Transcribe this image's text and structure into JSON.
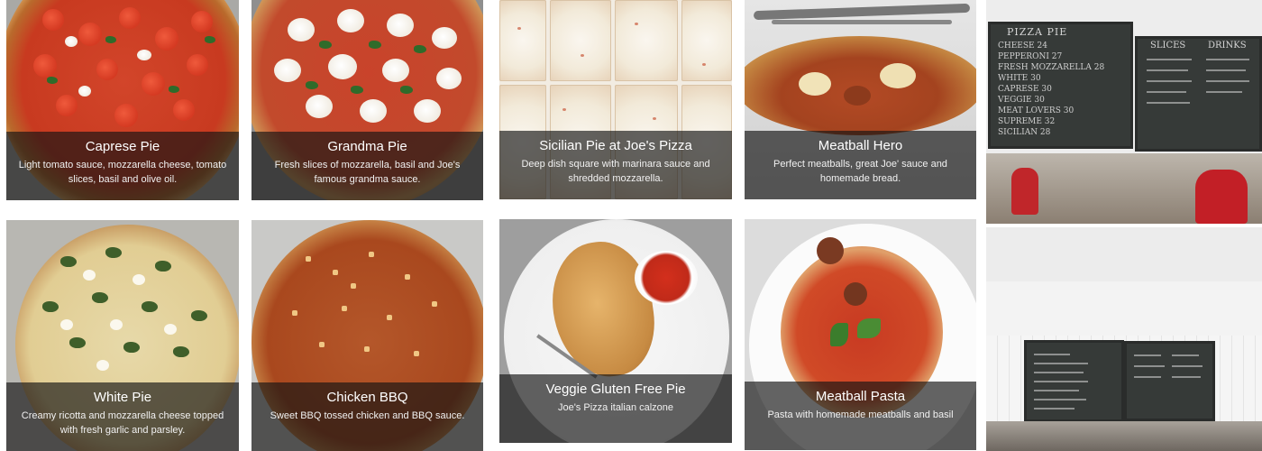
{
  "menu_cards": [
    {
      "title": "Caprese Pie",
      "desc": "Light tomato sauce, mozzarella cheese, tomato slices, basil and olive oil."
    },
    {
      "title": "Grandma Pie",
      "desc": "Fresh slices of mozzarella, basil and Joe's famous grandma sauce."
    },
    {
      "title": "Sicilian Pie at Joe's Pizza",
      "desc": "Deep dish square with marinara sauce and shredded mozzarella."
    },
    {
      "title": "Meatball Hero",
      "desc": "Perfect meatballs, great Joe' sauce and homemade bread."
    },
    {
      "title": "White Pie",
      "desc": "Creamy ricotta and mozzarella cheese topped with fresh garlic and parsley."
    },
    {
      "title": "Chicken BBQ",
      "desc": "Sweet BBQ tossed chicken and BBQ sauce."
    },
    {
      "title": "Veggie Gluten Free Pie",
      "desc": "Joe's Pizza italian calzone"
    },
    {
      "title": "Meatball Pasta",
      "desc": "Pasta with homemade meatballs and basil"
    }
  ],
  "menu_board": {
    "pie_header": "PIZZA PIE",
    "slices_header": "SLICES",
    "drinks_header": "DRINKS",
    "pie_items": [
      "CHEESE 24",
      "PEPPERONI 27",
      "FRESH MOZZARELLA 28",
      "WHITE 30",
      "CAPRESE 30",
      "VEGGIE 30",
      "MEAT LOVERS 30",
      "SUPREME 32",
      "SICILIAN 28"
    ]
  }
}
